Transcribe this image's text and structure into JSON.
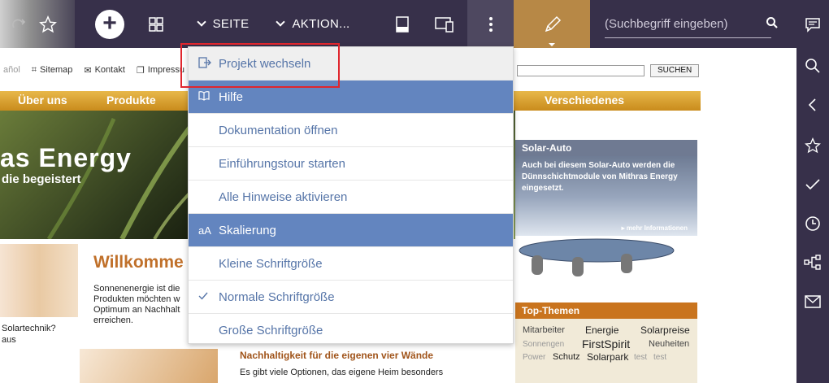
{
  "toolbar": {
    "seite_label": "SEITE",
    "aktion_label": "AKTION...",
    "search_placeholder": "(Suchbegriff eingeben)"
  },
  "website": {
    "meta": {
      "lang": "añol",
      "sitemap": "Sitemap",
      "kontakt": "Kontakt",
      "impressum": "Impressu"
    },
    "search_button": "SUCHEN",
    "nav": [
      "Über uns",
      "Produkte",
      "Verschiedenes"
    ],
    "hero_title": "as Energy",
    "hero_sub": "die begeistert",
    "solar_auto": {
      "title": "Solar-Auto",
      "text": "Auch bei diesem Solar-Auto werden die Dünnschichtmodule von Mithras Energy eingesetzt.",
      "more": "mehr Informationen"
    },
    "welcome": "Willkomme",
    "welcome_text": [
      "Sonnenenergie ist die",
      "Produkten möchten w",
      "Optimum an Nachhalt",
      "erreichen."
    ],
    "left_text": "Solartechnik?",
    "left_text2": "aus",
    "nachhaltig_title": "Nachhaltigkeit für die eigenen vier Wände",
    "nachhaltig_text": "Es gibt viele Optionen, das eigene Heim besonders",
    "top_themen": {
      "title": "Top-Themen",
      "tags": [
        "Mitarbeiter",
        "Energie",
        "Solarpreise",
        "Sonnengen",
        "FirstSpirit",
        "Neuheiten",
        "Power",
        "Schutz",
        "Solarpark",
        "test",
        "test"
      ]
    }
  },
  "menu": {
    "items": [
      {
        "label": "Projekt wechseln",
        "type": "item"
      },
      {
        "label": "Hilfe",
        "type": "header",
        "icon": "book-icon"
      },
      {
        "label": "Dokumentation öffnen",
        "type": "item"
      },
      {
        "label": "Einführungstour starten",
        "type": "item"
      },
      {
        "label": "Alle Hinweise aktivieren",
        "type": "item"
      },
      {
        "label": "Skalierung",
        "type": "header",
        "icon_text": "aA"
      },
      {
        "label": "Kleine Schriftgröße",
        "type": "item"
      },
      {
        "label": "Normale Schriftgröße",
        "type": "item",
        "checked": true
      },
      {
        "label": "Große Schriftgröße",
        "type": "item"
      }
    ]
  },
  "colors": {
    "toolbar": "#37304a",
    "accent": "#6385bf",
    "highlight": "#e0262d",
    "pencil": "#b78846"
  }
}
